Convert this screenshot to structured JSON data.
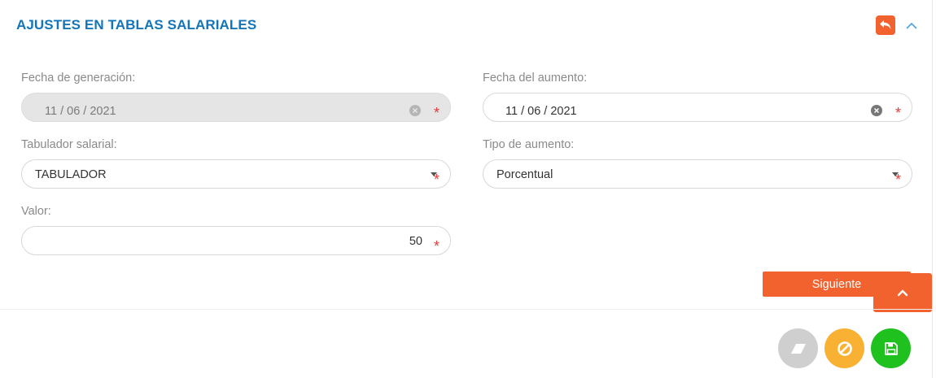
{
  "header": {
    "title": "AJUSTES EN TABLAS SALARIALES",
    "back_icon": "reply-arrow-icon",
    "collapse_icon": "chevron-up-icon",
    "accent_color": "#f2622e",
    "title_color": "#1476b8"
  },
  "form": {
    "fecha_generacion": {
      "label": "Fecha de generación:",
      "value": "11 / 06 / 2021",
      "required_mark": "*"
    },
    "fecha_aumento": {
      "label": "Fecha del aumento:",
      "value": "11 / 06 / 2021",
      "required_mark": "*"
    },
    "tabulador": {
      "label": "Tabulador salarial:",
      "value": "TABULADOR",
      "required_mark": "*"
    },
    "tipo_aumento": {
      "label": "Tipo de aumento:",
      "value": "Porcentual",
      "required_mark": "*"
    },
    "valor": {
      "label": "Valor:",
      "value": "50",
      "required_mark": "*"
    }
  },
  "actions": {
    "next_label": "Siguiente",
    "scroll_top_icon": "chevron-up-icon",
    "clean_icon": "eraser-icon",
    "cancel_icon": "ban-icon",
    "save_icon": "floppy-disk-icon"
  }
}
